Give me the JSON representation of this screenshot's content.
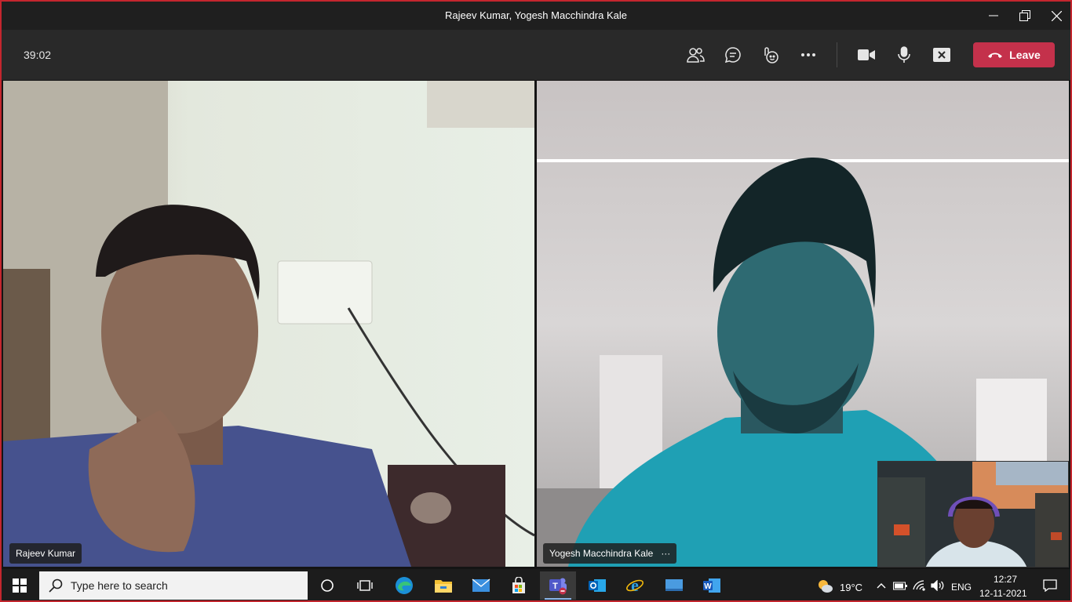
{
  "window": {
    "title": "Rajeev Kumar, Yogesh Macchindra Kale"
  },
  "meeting": {
    "timer": "39:02",
    "leave_label": "Leave",
    "toolbar_icons": [
      "people-icon",
      "chat-icon",
      "reactions-icon",
      "more-icon",
      "camera-icon",
      "mic-icon",
      "share-tray-icon",
      "phone-hangup-icon"
    ]
  },
  "participants": [
    {
      "name": "Rajeev Kumar"
    },
    {
      "name": "Yogesh Macchindra Kale",
      "more": "···"
    }
  ],
  "taskbar": {
    "search_placeholder": "Type here to search",
    "apps": [
      "windows-icon",
      "cortana-icon",
      "task-view-icon",
      "edge-icon",
      "file-explorer-icon",
      "mail-icon",
      "store-icon",
      "teams-icon",
      "outlook-icon",
      "internet-explorer-icon",
      "desktop-icon",
      "word-icon"
    ],
    "weather": "19°C",
    "language": "ENG",
    "time": "12:27",
    "date": "12-11-2021"
  },
  "colors": {
    "accent_border": "#c4262e",
    "leave_button": "#c4314b",
    "title_bar": "#1f1f1f",
    "meeting_bar": "#292929"
  }
}
